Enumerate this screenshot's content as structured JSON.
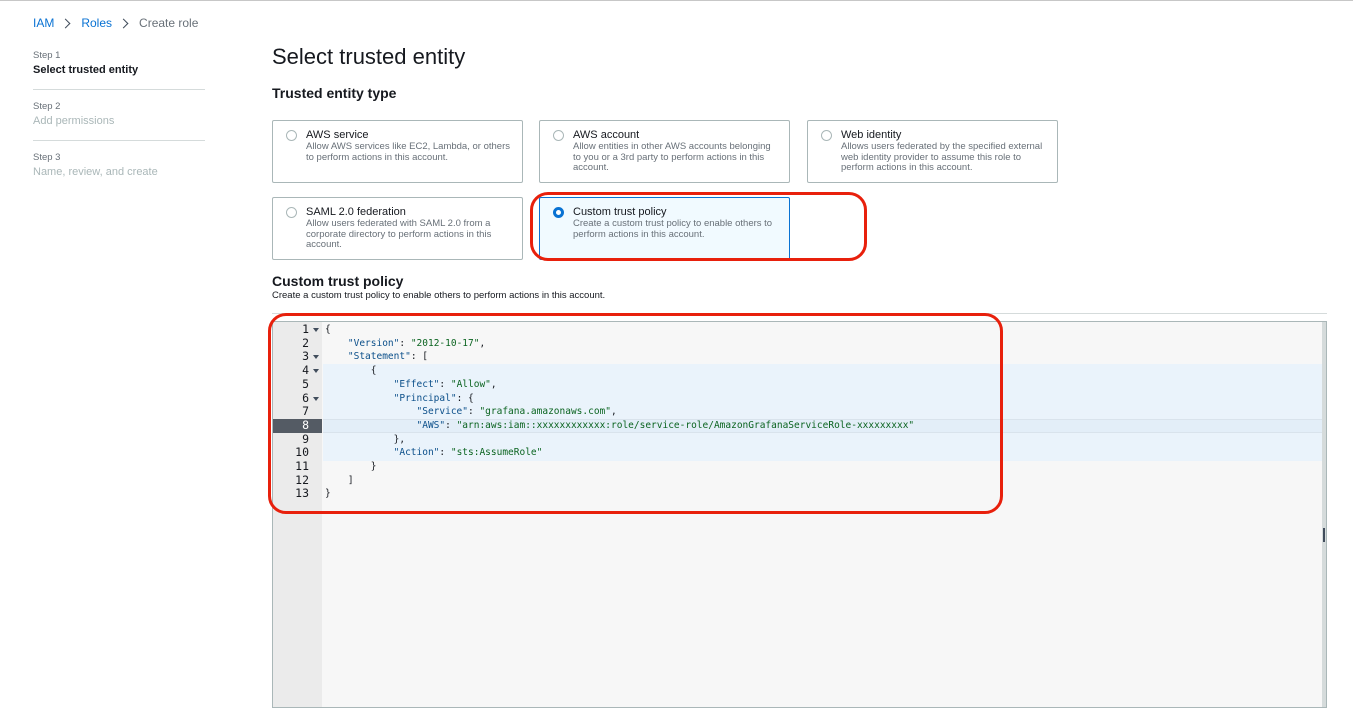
{
  "breadcrumb": {
    "iam": "IAM",
    "roles": "Roles",
    "current": "Create role"
  },
  "steps": [
    {
      "num": "Step 1",
      "title": "Select trusted entity"
    },
    {
      "num": "Step 2",
      "title": "Add permissions"
    },
    {
      "num": "Step 3",
      "title": "Name, review, and create"
    }
  ],
  "page_title": "Select trusted entity",
  "entity_section_title": "Trusted entity type",
  "entity_types": [
    {
      "title": "AWS service",
      "desc": "Allow AWS services like EC2, Lambda, or others to perform actions in this account."
    },
    {
      "title": "AWS account",
      "desc": "Allow entities in other AWS accounts belonging to you or a 3rd party to perform actions in this account."
    },
    {
      "title": "Web identity",
      "desc": "Allows users federated by the specified external web identity provider to assume this role to perform actions in this account."
    },
    {
      "title": "SAML 2.0 federation",
      "desc": "Allow users federated with SAML 2.0 from a corporate directory to perform actions in this account."
    },
    {
      "title": "Custom trust policy",
      "desc": "Create a custom trust policy to enable others to perform actions in this account."
    }
  ],
  "selected_entity": "Custom trust policy",
  "policy_section": {
    "title": "Custom trust policy",
    "desc": "Create a custom trust policy to enable others to perform actions in this account."
  },
  "editor": {
    "line_numbers": [
      "1",
      "2",
      "3",
      "4",
      "5",
      "6",
      "7",
      "8",
      "9",
      "10",
      "11",
      "12",
      "13"
    ],
    "active_line": "8",
    "lines": [
      "{",
      "    \"Version\": \"2012-10-17\",",
      "    \"Statement\": [",
      "        {",
      "            \"Effect\": \"Allow\",",
      "            \"Principal\": {",
      "                \"Service\": \"grafana.amazonaws.com\",",
      "                \"AWS\": \"arn:aws:iam::xxxxxxxxxxxx:role/service-role/AmazonGrafanaServiceRole-xxxxxxxxx\"",
      "            },",
      "            \"Action\": \"sts:AssumeRole\"",
      "        }",
      "    ]",
      "}"
    ]
  },
  "colors": {
    "accent": "#0972d3",
    "annotation": "#e8200c",
    "string": "#0b6420"
  }
}
